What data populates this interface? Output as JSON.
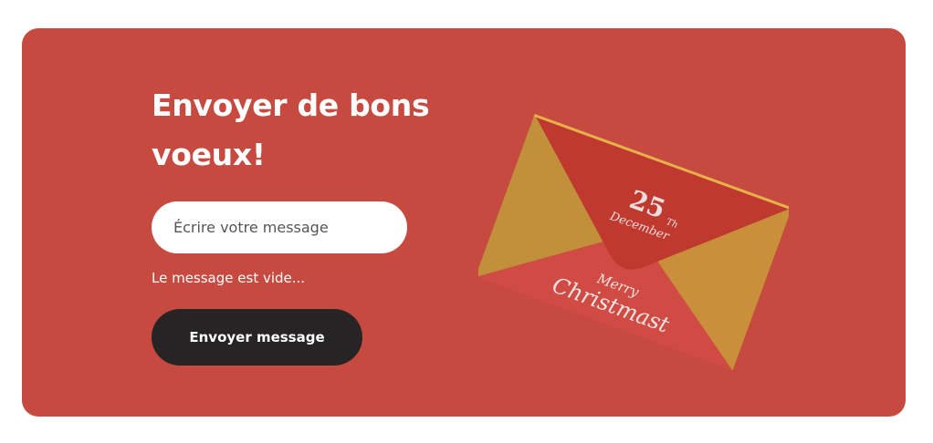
{
  "card": {
    "background": "#c64a40",
    "title": "Envoyer de bons voeux!",
    "input": {
      "placeholder": "Écrire votre message",
      "value": ""
    },
    "error_text": "Le message est vide...",
    "send_label": "Envoyer message"
  },
  "envelope": {
    "date_number": "25",
    "date_suffix": "Th",
    "date_month": "December",
    "greeting_line1": "Merry",
    "greeting_line2": "Christmast",
    "colors": {
      "body": "#c8443c",
      "flap": "#c2903a",
      "gold": "#e6b04a"
    }
  }
}
